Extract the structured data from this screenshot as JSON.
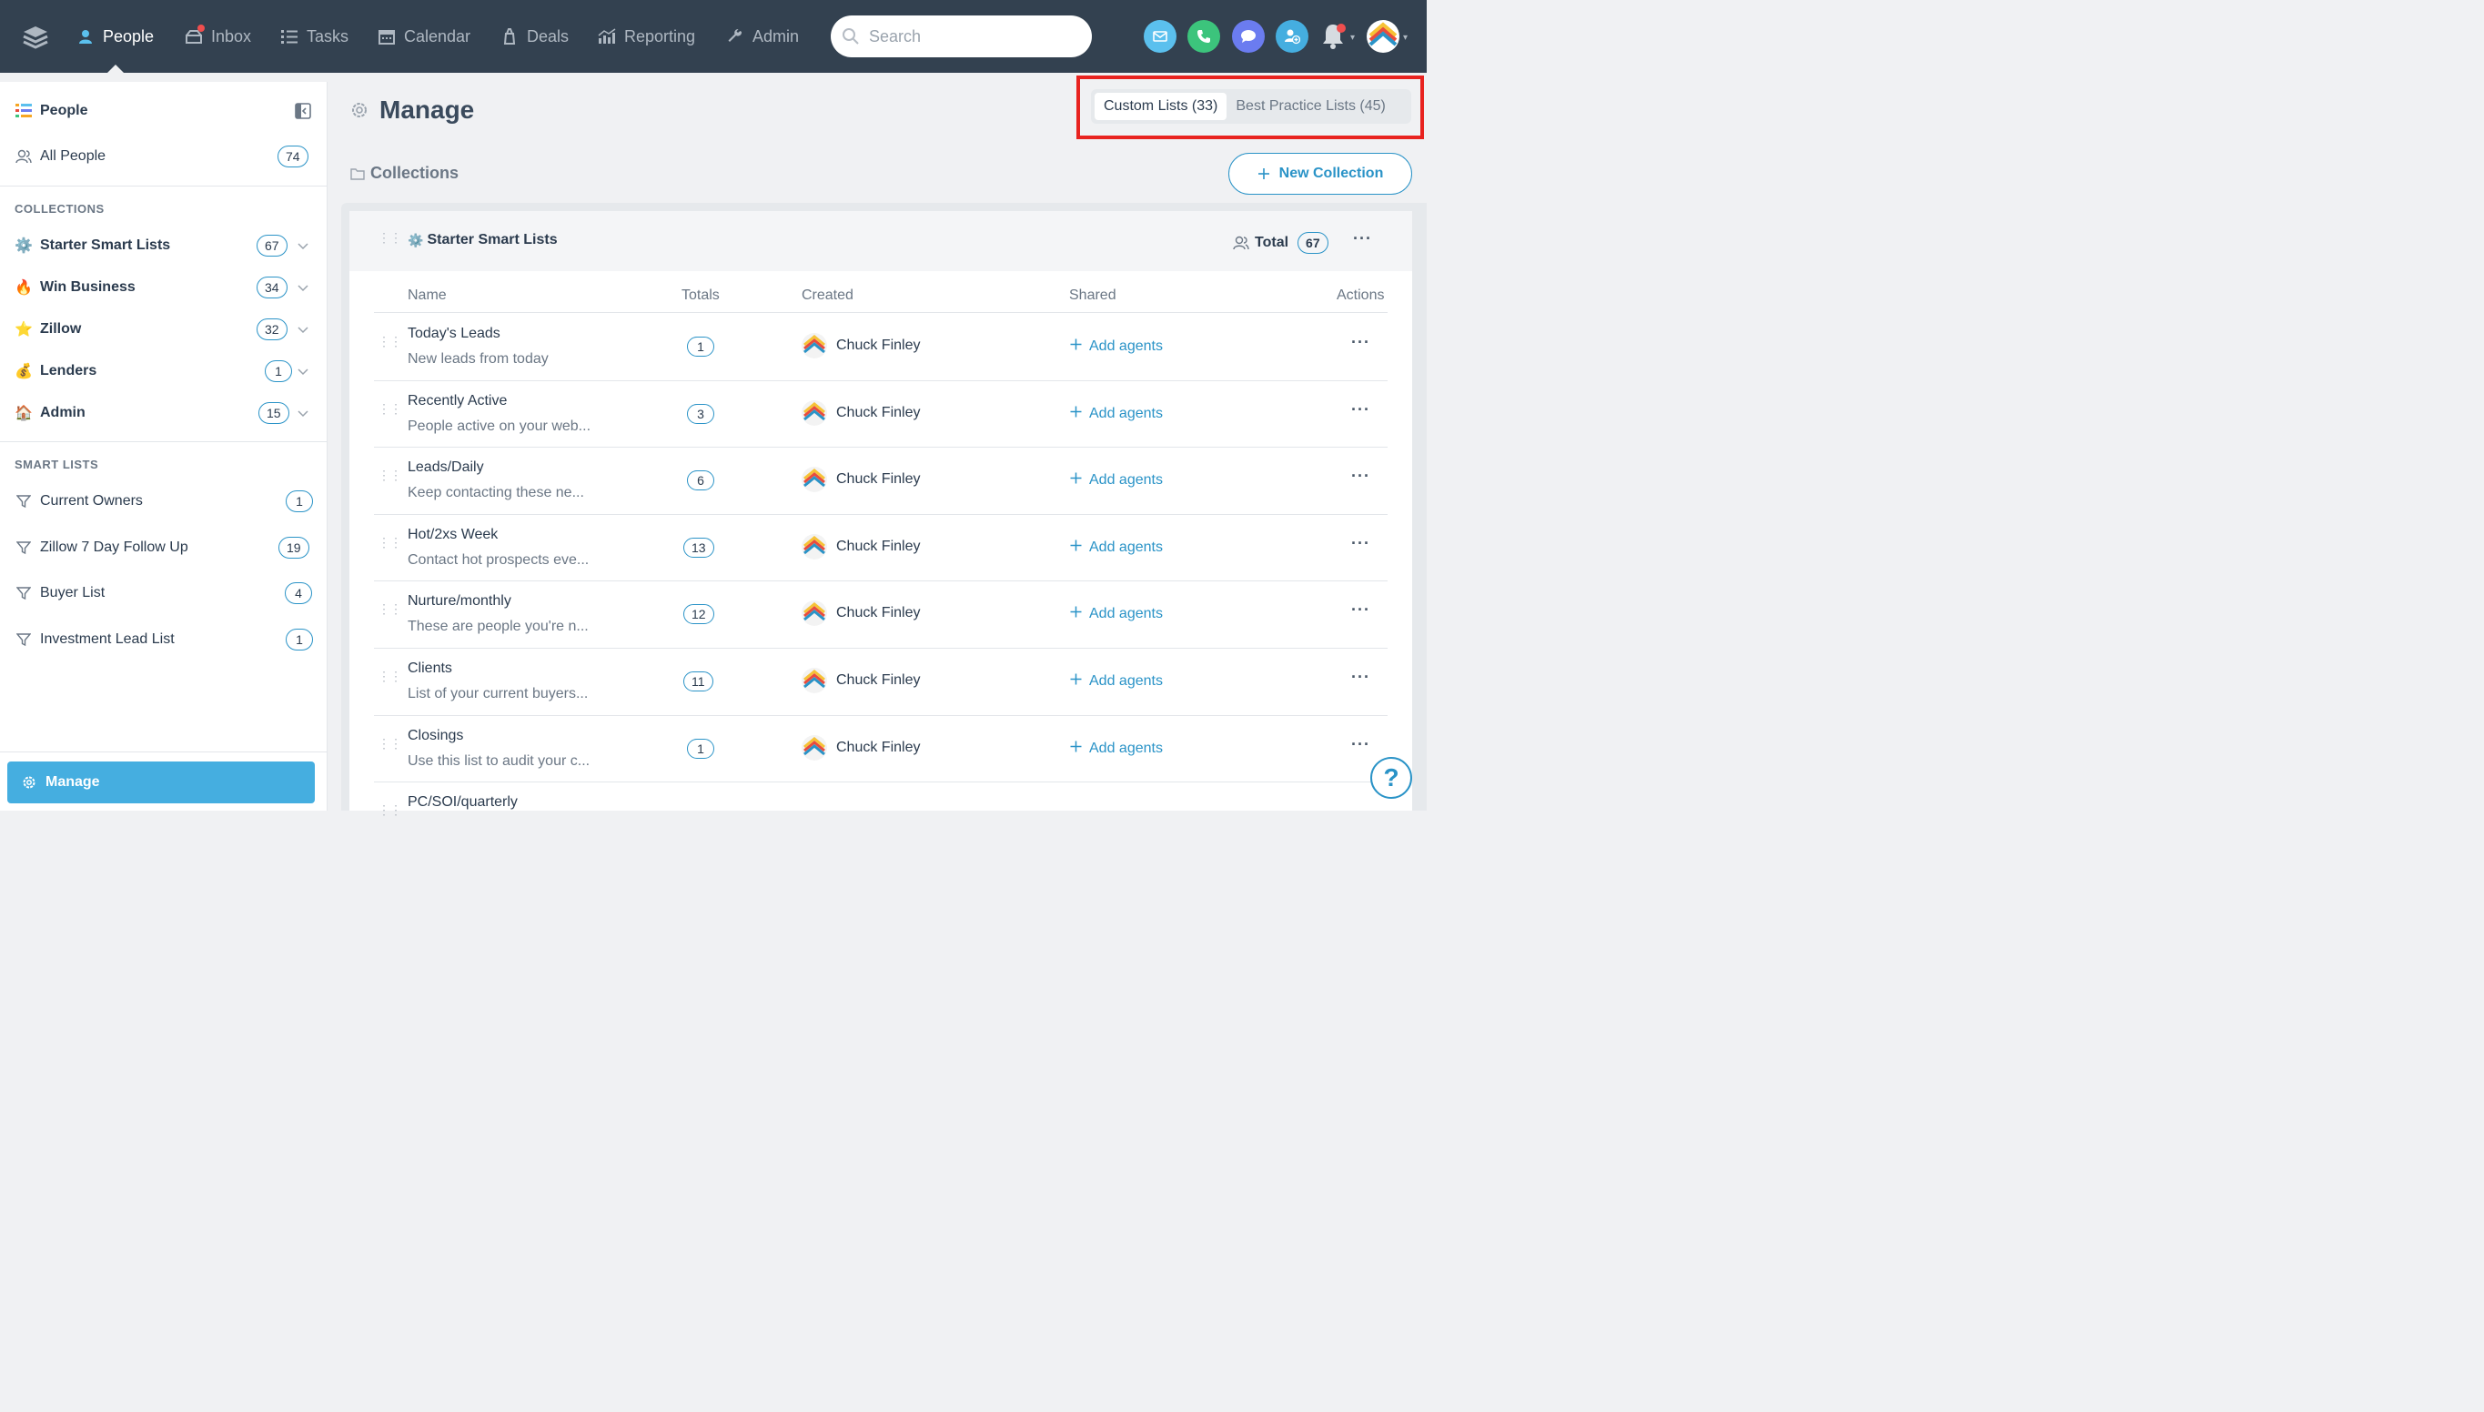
{
  "nav": {
    "items": [
      {
        "label": "People",
        "icon": "people-icon",
        "active": true
      },
      {
        "label": "Inbox",
        "icon": "inbox-icon",
        "active": false
      },
      {
        "label": "Tasks",
        "icon": "tasks-icon",
        "active": false
      },
      {
        "label": "Calendar",
        "icon": "calendar-icon",
        "active": false
      },
      {
        "label": "Deals",
        "icon": "deals-icon",
        "active": false
      },
      {
        "label": "Reporting",
        "icon": "reporting-icon",
        "active": false
      },
      {
        "label": "Admin",
        "icon": "wrench-icon",
        "active": false
      }
    ],
    "search_placeholder": "Search",
    "quick_actions": [
      {
        "icon": "email-icon",
        "color": "#5bc0ee"
      },
      {
        "icon": "phone-icon",
        "color": "#3cc47c"
      },
      {
        "icon": "chat-icon",
        "color": "#6b7cf0"
      },
      {
        "icon": "add-person-icon",
        "color": "#45aee0"
      }
    ]
  },
  "sidebar": {
    "title": "People",
    "all_people": {
      "label": "All People",
      "count": "74"
    },
    "collections_heading": "COLLECTIONS",
    "collections": [
      {
        "label": "Starter Smart Lists",
        "emoji": "⚙️",
        "count": "67"
      },
      {
        "label": "Win Business",
        "emoji": "🔥",
        "count": "34"
      },
      {
        "label": "Zillow",
        "emoji": "⭐",
        "count": "32"
      },
      {
        "label": "Lenders",
        "emoji": "💰",
        "count": "1"
      },
      {
        "label": "Admin",
        "emoji": "🏠",
        "count": "15"
      }
    ],
    "smart_lists_heading": "SMART LISTS",
    "smart_lists": [
      {
        "label": "Current Owners",
        "count": "1"
      },
      {
        "label": "Zillow 7 Day Follow Up",
        "count": "19"
      },
      {
        "label": "Buyer List",
        "count": "4"
      },
      {
        "label": "Investment Lead List",
        "count": "1"
      }
    ],
    "manage_label": "Manage"
  },
  "main": {
    "title": "Manage",
    "tabs": [
      {
        "label": "Custom Lists (33)",
        "active": true
      },
      {
        "label": "Best Practice Lists (45)",
        "active": false
      }
    ],
    "collections_label": "Collections",
    "new_collection_label": "New Collection",
    "panel": {
      "title": "Starter Smart Lists",
      "total_label": "Total",
      "total_count": "67",
      "columns": [
        "Name",
        "Totals",
        "Created",
        "Shared",
        "Actions"
      ],
      "rows": [
        {
          "name": "Today's Leads",
          "desc": "New leads from today",
          "total": "1",
          "creator": "Chuck Finley",
          "shared": "Add agents"
        },
        {
          "name": "Recently Active",
          "desc": "People active on your web...",
          "total": "3",
          "creator": "Chuck Finley",
          "shared": "Add agents"
        },
        {
          "name": "Leads/Daily",
          "desc": "Keep contacting these ne...",
          "total": "6",
          "creator": "Chuck Finley",
          "shared": "Add agents"
        },
        {
          "name": "Hot/2xs Week",
          "desc": "Contact hot prospects eve...",
          "total": "13",
          "creator": "Chuck Finley",
          "shared": "Add agents"
        },
        {
          "name": "Nurture/monthly",
          "desc": "These are people you're n...",
          "total": "12",
          "creator": "Chuck Finley",
          "shared": "Add agents"
        },
        {
          "name": "Clients",
          "desc": "List of your current buyers...",
          "total": "11",
          "creator": "Chuck Finley",
          "shared": "Add agents"
        },
        {
          "name": "Closings",
          "desc": "Use this list to audit your c...",
          "total": "1",
          "creator": "Chuck Finley",
          "shared": "Add agents"
        },
        {
          "name": "PC/SOI/quarterly",
          "desc": "",
          "total": "",
          "creator": "",
          "shared": ""
        }
      ]
    },
    "help_label": "?"
  },
  "colors": {
    "nav_bg": "#334150",
    "accent": "#2a93c7",
    "manage_button": "#45aee0",
    "highlight_box": "#e8231f"
  }
}
